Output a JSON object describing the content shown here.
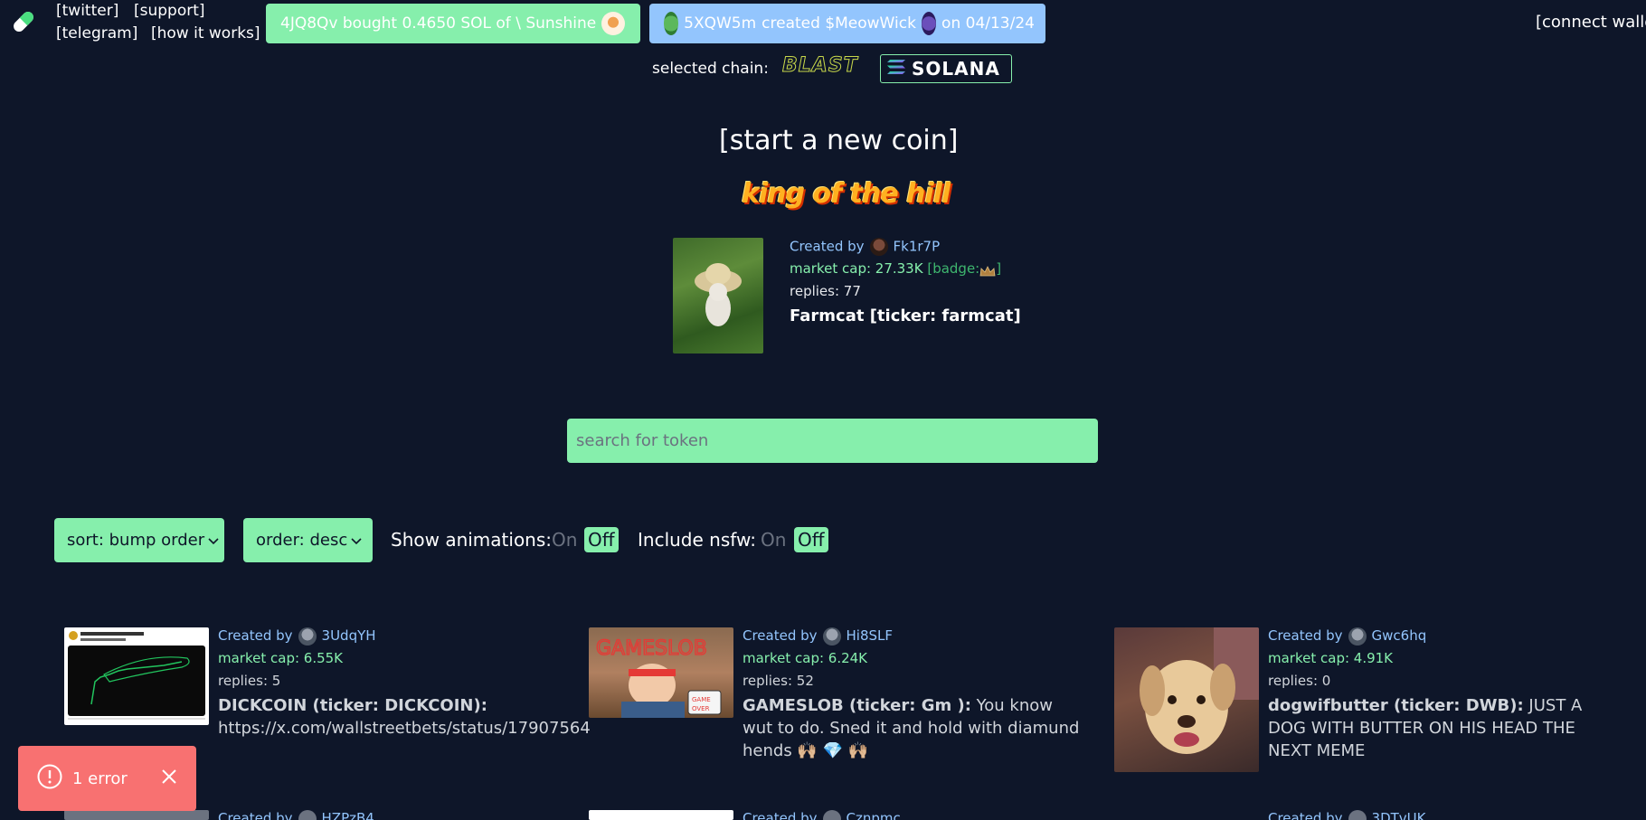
{
  "header": {
    "links": [
      "[twitter]",
      "[support]",
      "[telegram]",
      "[how it works]"
    ],
    "ticker_buy": "4JQ8Qv  bought 0.4650 SOL of \\ Sunshine",
    "ticker_create": {
      "user": "5XQW5m",
      "middle": "created $MeowWick",
      "date": "on 04/13/24"
    },
    "connect_wallet": "[connect wallet]"
  },
  "chain": {
    "label": "selected chain:",
    "options": [
      "BLAST",
      "SOLANA"
    ],
    "selected": "SOLANA"
  },
  "start_coin": "[start a new coin]",
  "king_of_the_hill": {
    "banner": "king of the hill",
    "created_by_label": "Created by",
    "creator": "Fk1r7P",
    "market_cap": "market cap: 27.33K",
    "badge": "[badge:",
    "badge_end": "]",
    "replies": "replies: 77",
    "name": "Farmcat [ticker: farmcat]"
  },
  "search": {
    "placeholder": "search for token"
  },
  "controls": {
    "sort": "sort: bump order",
    "order": "order: desc",
    "animations_label": "Show animations:",
    "nsfw_label": "Include nsfw:",
    "on": "On",
    "off": "Off"
  },
  "coins": [
    {
      "created_by": "Created by",
      "creator": "3UdqYH",
      "market_cap": "market cap: 6.55K",
      "replies": "replies: 5",
      "title": "DICKCOIN (ticker: DICKCOIN):",
      "description": "https://x.com/wallstreetbets/status/17907564"
    },
    {
      "created_by": "Created by",
      "creator": "Hi8SLF",
      "market_cap": "market cap: 6.24K",
      "replies": "replies: 52",
      "title": "GAMESLOB (ticker: Gm ):",
      "description": "You know wut to do. Sned it and hold with diamund hends 🙌🏼 💎 🙌🏼"
    },
    {
      "created_by": "Created by",
      "creator": "Gwc6hq",
      "market_cap": "market cap: 4.91K",
      "replies": "replies: 0",
      "title": "dogwifbutter (ticker: DWB):",
      "description": "JUST A DOG WITH BUTTER ON HIS HEAD THE NEXT MEME"
    }
  ],
  "next_row_creators": [
    "HZPzB4",
    "Cznpmc",
    "3DTvUK"
  ],
  "error_toast": {
    "text": "1 error"
  },
  "colors": {
    "background": "#0e1629",
    "accent_green": "#86efac",
    "accent_blue": "#93c5fd",
    "error": "#f87171"
  }
}
